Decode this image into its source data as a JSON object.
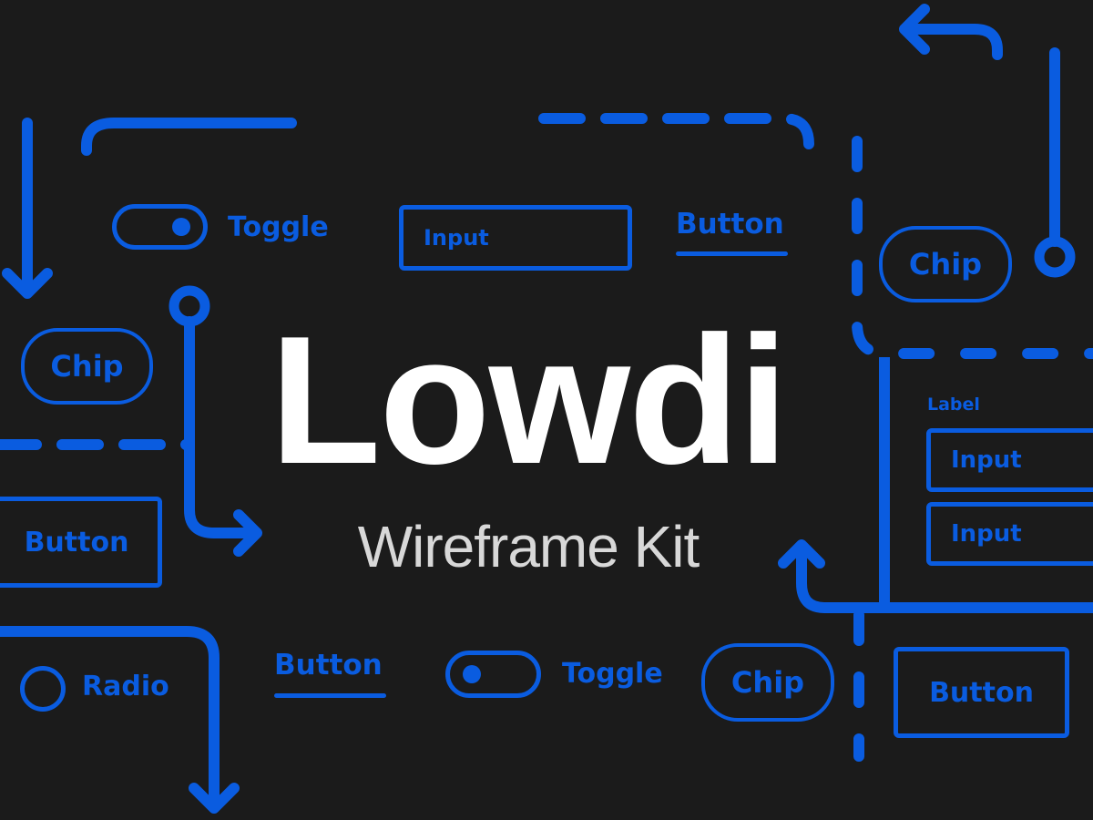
{
  "title": "Lowdi",
  "subtitle": "Wireframe Kit",
  "colors": {
    "background": "#1b1b1b",
    "accent": "#0a5ce0",
    "title": "#ffffff",
    "subtitle": "#d8d8d8"
  },
  "components": {
    "toggle_top": {
      "label": "Toggle",
      "state": "on"
    },
    "input_top": {
      "value": "Input"
    },
    "button_text_top": {
      "label": "Button"
    },
    "chip_top_right": {
      "label": "Chip"
    },
    "chip_left": {
      "label": "Chip"
    },
    "button_left": {
      "label": "Button"
    },
    "form": {
      "label": "Label",
      "input1": "Input",
      "input2": "Input"
    },
    "radio": {
      "label": "Radio",
      "state": "unchecked"
    },
    "button_text_bottom": {
      "label": "Button"
    },
    "toggle_bottom": {
      "label": "Toggle",
      "state": "off"
    },
    "chip_bottom": {
      "label": "Chip"
    },
    "button_bottom_right": {
      "label": "Button"
    }
  },
  "icons": [
    "arrow-down-icon",
    "arrow-right-icon",
    "arrow-up-icon",
    "arrow-left-icon",
    "connector-node-icon"
  ]
}
